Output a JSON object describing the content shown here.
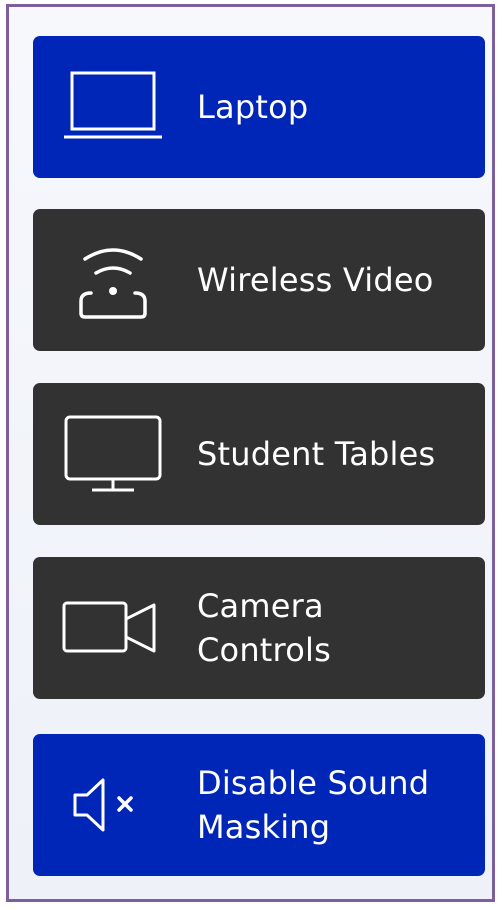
{
  "colors": {
    "panel_border": "#7d5f9e",
    "active_button": "#0026b8",
    "inactive_button": "#323232",
    "text": "#ffffff"
  },
  "buttons": [
    {
      "label": "Laptop",
      "icon": "laptop-icon",
      "state": "active"
    },
    {
      "label": "Wireless Video",
      "icon": "wireless-video-icon",
      "state": "inactive"
    },
    {
      "label": "Student Tables",
      "icon": "monitor-icon",
      "state": "inactive"
    },
    {
      "label": "Camera\nControls",
      "icon": "camera-icon",
      "state": "inactive"
    },
    {
      "label": "Disable Sound\nMasking",
      "icon": "speaker-mute-icon",
      "state": "active"
    }
  ]
}
